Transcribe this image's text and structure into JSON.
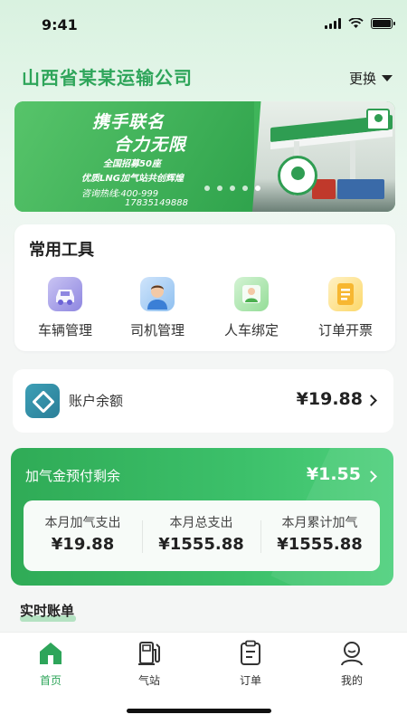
{
  "status_bar": {
    "time": "9:41"
  },
  "header": {
    "company": "山西省某某运输公司",
    "switch_label": "更换"
  },
  "banner": {
    "title_line1": "携手联名",
    "title_line2": "合力无限",
    "sub_line1": "全国招募50座",
    "sub_line2": "优质LNG加气站共创辉煌",
    "hotline": "咨询热线:400-999",
    "phone2": "17835149888",
    "slide_count": 5,
    "active_slide": 5
  },
  "tools": {
    "title": "常用工具",
    "items": [
      {
        "label": "车辆管理",
        "icon": "car-icon"
      },
      {
        "label": "司机管理",
        "icon": "driver-icon"
      },
      {
        "label": "人车绑定",
        "icon": "bind-icon"
      },
      {
        "label": "订单开票",
        "icon": "invoice-icon"
      }
    ]
  },
  "balance": {
    "label": "账户余额",
    "amount": "¥19.88"
  },
  "gas_prepay": {
    "label": "加气金预付剩余",
    "amount": "¥1.55",
    "stats": [
      {
        "label": "本月加气支出",
        "value": "¥19.88"
      },
      {
        "label": "本月总支出",
        "value": "¥1555.88"
      },
      {
        "label": "本月累计加气",
        "value": "¥1555.88"
      }
    ]
  },
  "bills": {
    "title": "实时账单"
  },
  "tabbar": {
    "items": [
      {
        "label": "首页",
        "icon": "home-icon",
        "active": true
      },
      {
        "label": "气站",
        "icon": "gas-station-icon",
        "active": false
      },
      {
        "label": "订单",
        "icon": "order-icon",
        "active": false
      },
      {
        "label": "我的",
        "icon": "profile-icon",
        "active": false
      }
    ]
  },
  "colors": {
    "accent": "#2ea55a",
    "banner_green": "#3fb55a",
    "balance_icon": "#3d9fb6"
  }
}
